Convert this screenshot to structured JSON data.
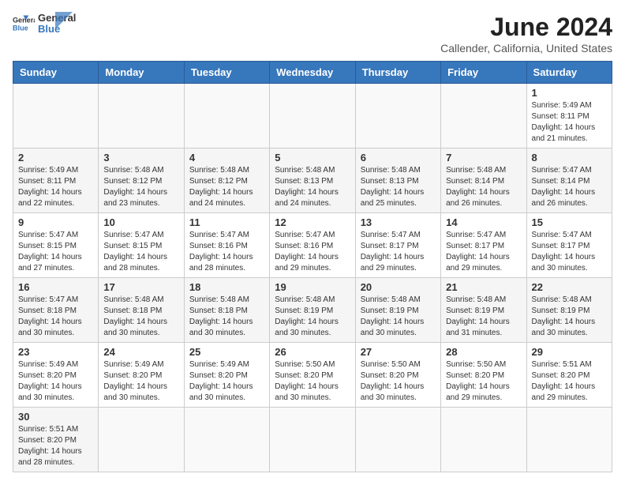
{
  "header": {
    "logo_line1": "General",
    "logo_line2": "Blue",
    "month_title": "June 2024",
    "subtitle": "Callender, California, United States"
  },
  "weekdays": [
    "Sunday",
    "Monday",
    "Tuesday",
    "Wednesday",
    "Thursday",
    "Friday",
    "Saturday"
  ],
  "weeks": [
    [
      {
        "day": "",
        "info": ""
      },
      {
        "day": "",
        "info": ""
      },
      {
        "day": "",
        "info": ""
      },
      {
        "day": "",
        "info": ""
      },
      {
        "day": "",
        "info": ""
      },
      {
        "day": "",
        "info": ""
      },
      {
        "day": "1",
        "info": "Sunrise: 5:49 AM\nSunset: 8:11 PM\nDaylight: 14 hours\nand 21 minutes."
      }
    ],
    [
      {
        "day": "2",
        "info": "Sunrise: 5:49 AM\nSunset: 8:11 PM\nDaylight: 14 hours\nand 22 minutes."
      },
      {
        "day": "3",
        "info": "Sunrise: 5:48 AM\nSunset: 8:12 PM\nDaylight: 14 hours\nand 23 minutes."
      },
      {
        "day": "4",
        "info": "Sunrise: 5:48 AM\nSunset: 8:12 PM\nDaylight: 14 hours\nand 24 minutes."
      },
      {
        "day": "5",
        "info": "Sunrise: 5:48 AM\nSunset: 8:13 PM\nDaylight: 14 hours\nand 24 minutes."
      },
      {
        "day": "6",
        "info": "Sunrise: 5:48 AM\nSunset: 8:13 PM\nDaylight: 14 hours\nand 25 minutes."
      },
      {
        "day": "7",
        "info": "Sunrise: 5:48 AM\nSunset: 8:14 PM\nDaylight: 14 hours\nand 26 minutes."
      },
      {
        "day": "8",
        "info": "Sunrise: 5:47 AM\nSunset: 8:14 PM\nDaylight: 14 hours\nand 26 minutes."
      }
    ],
    [
      {
        "day": "9",
        "info": "Sunrise: 5:47 AM\nSunset: 8:15 PM\nDaylight: 14 hours\nand 27 minutes."
      },
      {
        "day": "10",
        "info": "Sunrise: 5:47 AM\nSunset: 8:15 PM\nDaylight: 14 hours\nand 28 minutes."
      },
      {
        "day": "11",
        "info": "Sunrise: 5:47 AM\nSunset: 8:16 PM\nDaylight: 14 hours\nand 28 minutes."
      },
      {
        "day": "12",
        "info": "Sunrise: 5:47 AM\nSunset: 8:16 PM\nDaylight: 14 hours\nand 29 minutes."
      },
      {
        "day": "13",
        "info": "Sunrise: 5:47 AM\nSunset: 8:17 PM\nDaylight: 14 hours\nand 29 minutes."
      },
      {
        "day": "14",
        "info": "Sunrise: 5:47 AM\nSunset: 8:17 PM\nDaylight: 14 hours\nand 29 minutes."
      },
      {
        "day": "15",
        "info": "Sunrise: 5:47 AM\nSunset: 8:17 PM\nDaylight: 14 hours\nand 30 minutes."
      }
    ],
    [
      {
        "day": "16",
        "info": "Sunrise: 5:47 AM\nSunset: 8:18 PM\nDaylight: 14 hours\nand 30 minutes."
      },
      {
        "day": "17",
        "info": "Sunrise: 5:48 AM\nSunset: 8:18 PM\nDaylight: 14 hours\nand 30 minutes."
      },
      {
        "day": "18",
        "info": "Sunrise: 5:48 AM\nSunset: 8:18 PM\nDaylight: 14 hours\nand 30 minutes."
      },
      {
        "day": "19",
        "info": "Sunrise: 5:48 AM\nSunset: 8:19 PM\nDaylight: 14 hours\nand 30 minutes."
      },
      {
        "day": "20",
        "info": "Sunrise: 5:48 AM\nSunset: 8:19 PM\nDaylight: 14 hours\nand 30 minutes."
      },
      {
        "day": "21",
        "info": "Sunrise: 5:48 AM\nSunset: 8:19 PM\nDaylight: 14 hours\nand 31 minutes."
      },
      {
        "day": "22",
        "info": "Sunrise: 5:48 AM\nSunset: 8:19 PM\nDaylight: 14 hours\nand 30 minutes."
      }
    ],
    [
      {
        "day": "23",
        "info": "Sunrise: 5:49 AM\nSunset: 8:20 PM\nDaylight: 14 hours\nand 30 minutes."
      },
      {
        "day": "24",
        "info": "Sunrise: 5:49 AM\nSunset: 8:20 PM\nDaylight: 14 hours\nand 30 minutes."
      },
      {
        "day": "25",
        "info": "Sunrise: 5:49 AM\nSunset: 8:20 PM\nDaylight: 14 hours\nand 30 minutes."
      },
      {
        "day": "26",
        "info": "Sunrise: 5:50 AM\nSunset: 8:20 PM\nDaylight: 14 hours\nand 30 minutes."
      },
      {
        "day": "27",
        "info": "Sunrise: 5:50 AM\nSunset: 8:20 PM\nDaylight: 14 hours\nand 30 minutes."
      },
      {
        "day": "28",
        "info": "Sunrise: 5:50 AM\nSunset: 8:20 PM\nDaylight: 14 hours\nand 29 minutes."
      },
      {
        "day": "29",
        "info": "Sunrise: 5:51 AM\nSunset: 8:20 PM\nDaylight: 14 hours\nand 29 minutes."
      }
    ],
    [
      {
        "day": "30",
        "info": "Sunrise: 5:51 AM\nSunset: 8:20 PM\nDaylight: 14 hours\nand 28 minutes."
      },
      {
        "day": "",
        "info": ""
      },
      {
        "day": "",
        "info": ""
      },
      {
        "day": "",
        "info": ""
      },
      {
        "day": "",
        "info": ""
      },
      {
        "day": "",
        "info": ""
      },
      {
        "day": "",
        "info": ""
      }
    ]
  ]
}
